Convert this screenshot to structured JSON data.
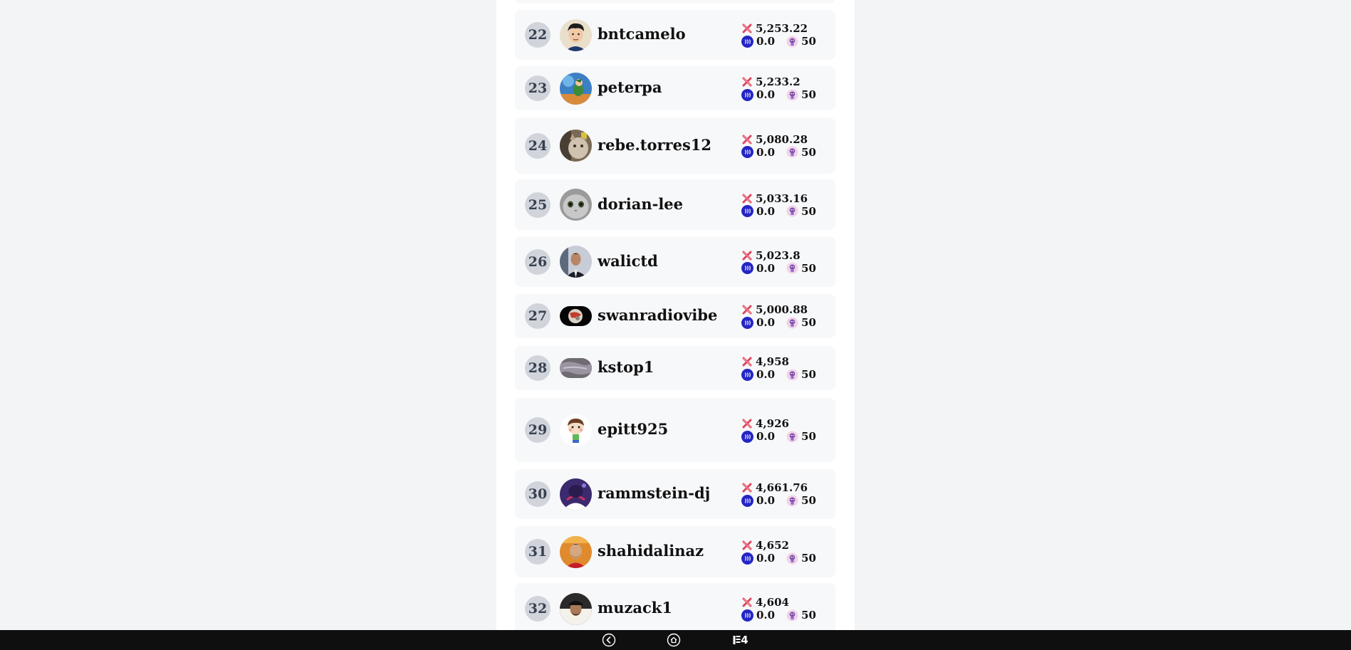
{
  "leaderboard": {
    "rows": [
      {
        "rank": "22",
        "username": "bntcamelo",
        "score": "5,253.22",
        "steem": "0.0",
        "pets": "50",
        "avatar": "man-cartoon-avatar"
      },
      {
        "rank": "23",
        "username": "peterpa",
        "score": "5,233.2",
        "steem": "0.0",
        "pets": "50",
        "avatar": "cartoon-character-avatar"
      },
      {
        "rank": "24",
        "username": "rebe.torres12",
        "score": "5,080.28",
        "steem": "0.0",
        "pets": "50",
        "avatar": "cat-photo-avatar"
      },
      {
        "rank": "25",
        "username": "dorian-lee",
        "score": "5,033.16",
        "steem": "0.0",
        "pets": "50",
        "avatar": "grey-cat-avatar"
      },
      {
        "rank": "26",
        "username": "walictd",
        "score": "5,023.8",
        "steem": "0.0",
        "pets": "50",
        "avatar": "man-suit-avatar"
      },
      {
        "rank": "27",
        "username": "swanradiovibe",
        "score": "5,000.88",
        "steem": "0.0",
        "pets": "50",
        "avatar": "planet-avatar"
      },
      {
        "rank": "28",
        "username": "kstop1",
        "score": "4,958",
        "steem": "0.0",
        "pets": "50",
        "avatar": "stone-avatar"
      },
      {
        "rank": "29",
        "username": "epitt925",
        "score": "4,926",
        "steem": "0.0",
        "pets": "50",
        "avatar": "cartoon-kid-avatar"
      },
      {
        "rank": "30",
        "username": "rammstein-dj",
        "score": "4,661.76",
        "steem": "0.0",
        "pets": "50",
        "avatar": "anime-avatar"
      },
      {
        "rank": "31",
        "username": "shahidalinaz",
        "score": "4,652",
        "steem": "0.0",
        "pets": "50",
        "avatar": "man-photo-avatar"
      },
      {
        "rank": "32",
        "username": "muzack1",
        "score": "4,604",
        "steem": "0.0",
        "pets": "50",
        "avatar": "man-cap-avatar"
      }
    ]
  },
  "bottom_nav": {
    "back_icon": "chevron-left-circle-icon",
    "home_icon": "home-circle-icon",
    "tabs_icon": "tabs-icon",
    "tabs_count": "4"
  },
  "colors": {
    "page_bg": "#f3f4f6",
    "panel_bg": "#ffffff",
    "card_bg": "#f7f8fa",
    "rank_badge": "#d1d5db",
    "steem_coin": "#2326c4",
    "score_icon": "#e0475b",
    "bottom_bar": "#0f0f0f"
  }
}
